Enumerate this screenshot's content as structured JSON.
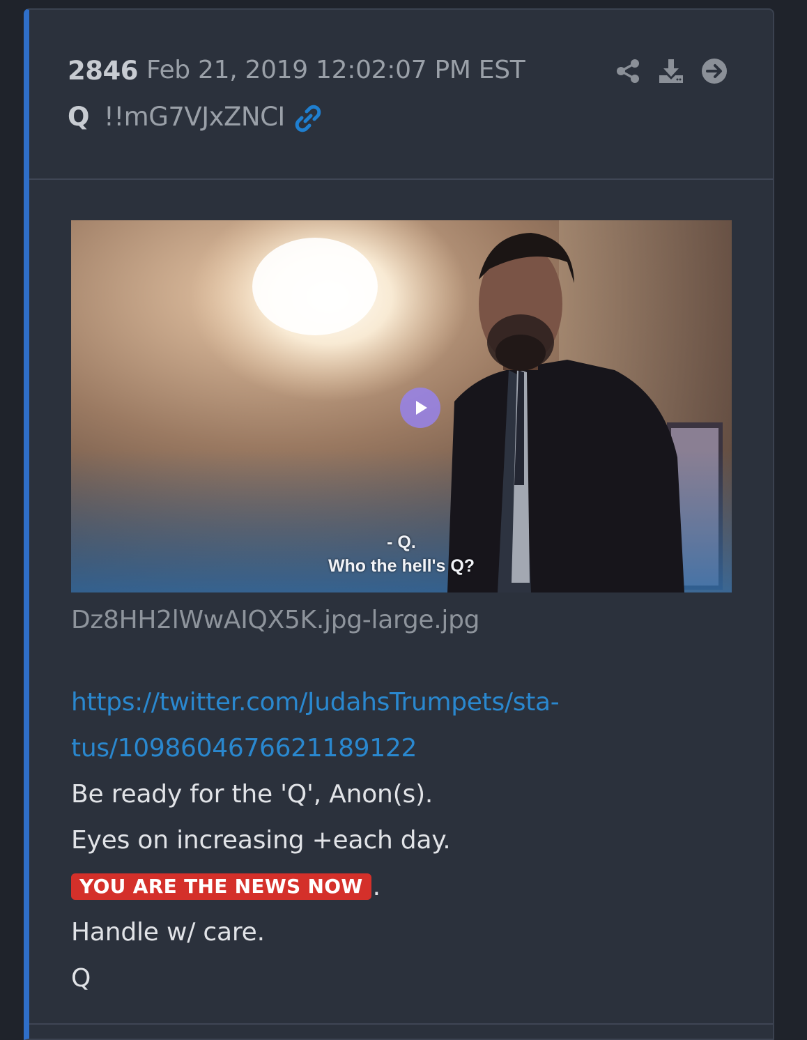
{
  "post": {
    "number": "2846",
    "date": "Feb 21, 2019 12:02:07 PM EST",
    "author": "Q",
    "tripcode": "!!mG7VJxZNCI"
  },
  "actions": {
    "icons": [
      "share-icon",
      "download-icon",
      "arrow-right-circle-icon"
    ]
  },
  "media": {
    "subtitle_line1": "- Q.",
    "subtitle_line2": "Who the hell's Q?",
    "filename": "Dz8HH2lWwAIQX5K.jpg-large.jpg"
  },
  "message": {
    "url_line1": "https://twitter.com/JudahsTrumpets/sta-",
    "url_line2": "tus/1098604676621189122",
    "line1": "Be ready for the 'Q', Anon(s).",
    "line2": "Eyes on increasing +each day.",
    "badge": "YOU ARE THE NEWS NOW",
    "badge_suffix": ".",
    "line3": "Handle w/ care.",
    "signature": "Q"
  },
  "colors": {
    "accent_bar": "#2f6fc9",
    "link": "#2a88cf",
    "badge_bg": "#d4302a",
    "card_bg": "#2b313c"
  }
}
